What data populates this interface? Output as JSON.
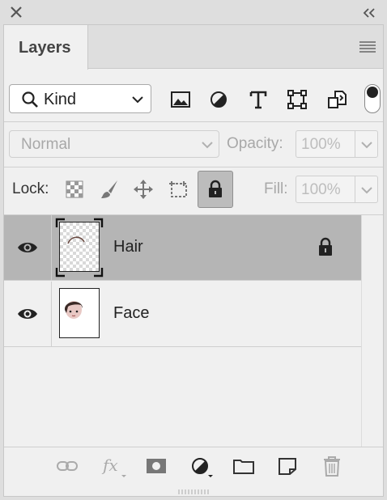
{
  "window": {
    "close_icon": "close-icon",
    "collapse_icon": "double-chevron-left-icon"
  },
  "panel": {
    "tab_label": "Layers",
    "menu_icon": "panel-menu-icon"
  },
  "filter": {
    "kind_label": "Kind",
    "icons": [
      "image-filter-icon",
      "adjustment-filter-icon",
      "type-filter-icon",
      "shape-filter-icon",
      "smart-object-filter-icon"
    ]
  },
  "blend": {
    "mode": "Normal",
    "opacity_label": "Opacity:",
    "opacity_value": "100%"
  },
  "lock": {
    "label": "Lock:",
    "icons": [
      "lock-transparent-pixels-icon",
      "lock-image-pixels-icon",
      "lock-position-icon",
      "lock-artboard-icon",
      "lock-all-icon"
    ],
    "fill_label": "Fill:",
    "fill_value": "100%"
  },
  "layers": [
    {
      "name": "Hair",
      "visible": true,
      "selected": true,
      "locked": true
    },
    {
      "name": "Face",
      "visible": true,
      "selected": false,
      "locked": false
    }
  ],
  "bottom_icons": [
    "link-layers-icon",
    "fx-icon",
    "add-mask-icon",
    "adjustment-layer-icon",
    "new-group-icon",
    "new-layer-icon",
    "delete-layer-icon"
  ],
  "colors": {
    "selected_row": "#b5b5b5",
    "panel_bg": "#f0f0f0",
    "chrome_bg": "#dedede"
  }
}
